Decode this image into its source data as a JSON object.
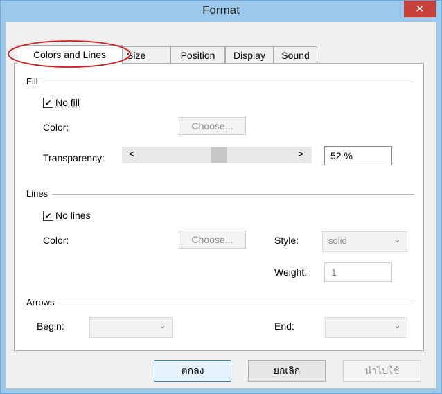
{
  "window": {
    "title": "Format",
    "close_glyph": "✕"
  },
  "tabs": [
    {
      "label": "Colors and Lines",
      "active": true
    },
    {
      "label": "Size"
    },
    {
      "label": "Position"
    },
    {
      "label": "Display"
    },
    {
      "label": "Sound"
    }
  ],
  "fill": {
    "group_label": "Fill",
    "no_fill_label": "No fill",
    "no_fill_checked": true,
    "color_label": "Color:",
    "choose_label": "Choose...",
    "transparency_label": "Transparency:",
    "transparency_value": "52 %",
    "slider_left_glyph": "<",
    "slider_right_glyph": ">"
  },
  "lines": {
    "group_label": "Lines",
    "no_lines_label": "No lines",
    "no_lines_checked": true,
    "color_label": "Color:",
    "choose_label": "Choose...",
    "style_label": "Style:",
    "style_value": "solid",
    "weight_label": "Weight:",
    "weight_value": "1"
  },
  "arrows": {
    "group_label": "Arrows",
    "begin_label": "Begin:",
    "end_label": "End:"
  },
  "footer": {
    "ok_label": "ตกลง",
    "cancel_label": "ยกเลิก",
    "apply_label": "นำไปใช้"
  },
  "check_glyph": "✔",
  "chevron_glyph": "⌄",
  "colors": {
    "titlebar": "#9cc8ec",
    "close": "#c7403a",
    "highlight_ellipse": "#d21f1f"
  }
}
